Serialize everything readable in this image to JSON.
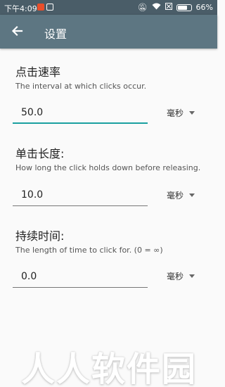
{
  "status_bar": {
    "time": "下午4:09",
    "battery": "66%",
    "icons": [
      "dnd-icon",
      "wifi-icon",
      "sim-icon",
      "battery-icon"
    ]
  },
  "app_bar": {
    "title": "设置",
    "back_icon": "arrow-back-icon"
  },
  "settings": [
    {
      "heading": "点击速率",
      "description": "The interval at which clicks occur.",
      "value": "50.0",
      "unit": "毫秒"
    },
    {
      "heading": "单击长度:",
      "description": "How long the click holds down before releasing.",
      "value": "10.0",
      "unit": "毫秒"
    },
    {
      "heading": "持续时间:",
      "description": "The length of time to click for. (0 = ∞)",
      "value": "0.0",
      "unit": "毫秒"
    }
  ],
  "watermark": "人人软件园",
  "colors": {
    "status_bar": "#4a5d68",
    "app_bar": "#5d7682",
    "accent": "#1aa0a0"
  }
}
